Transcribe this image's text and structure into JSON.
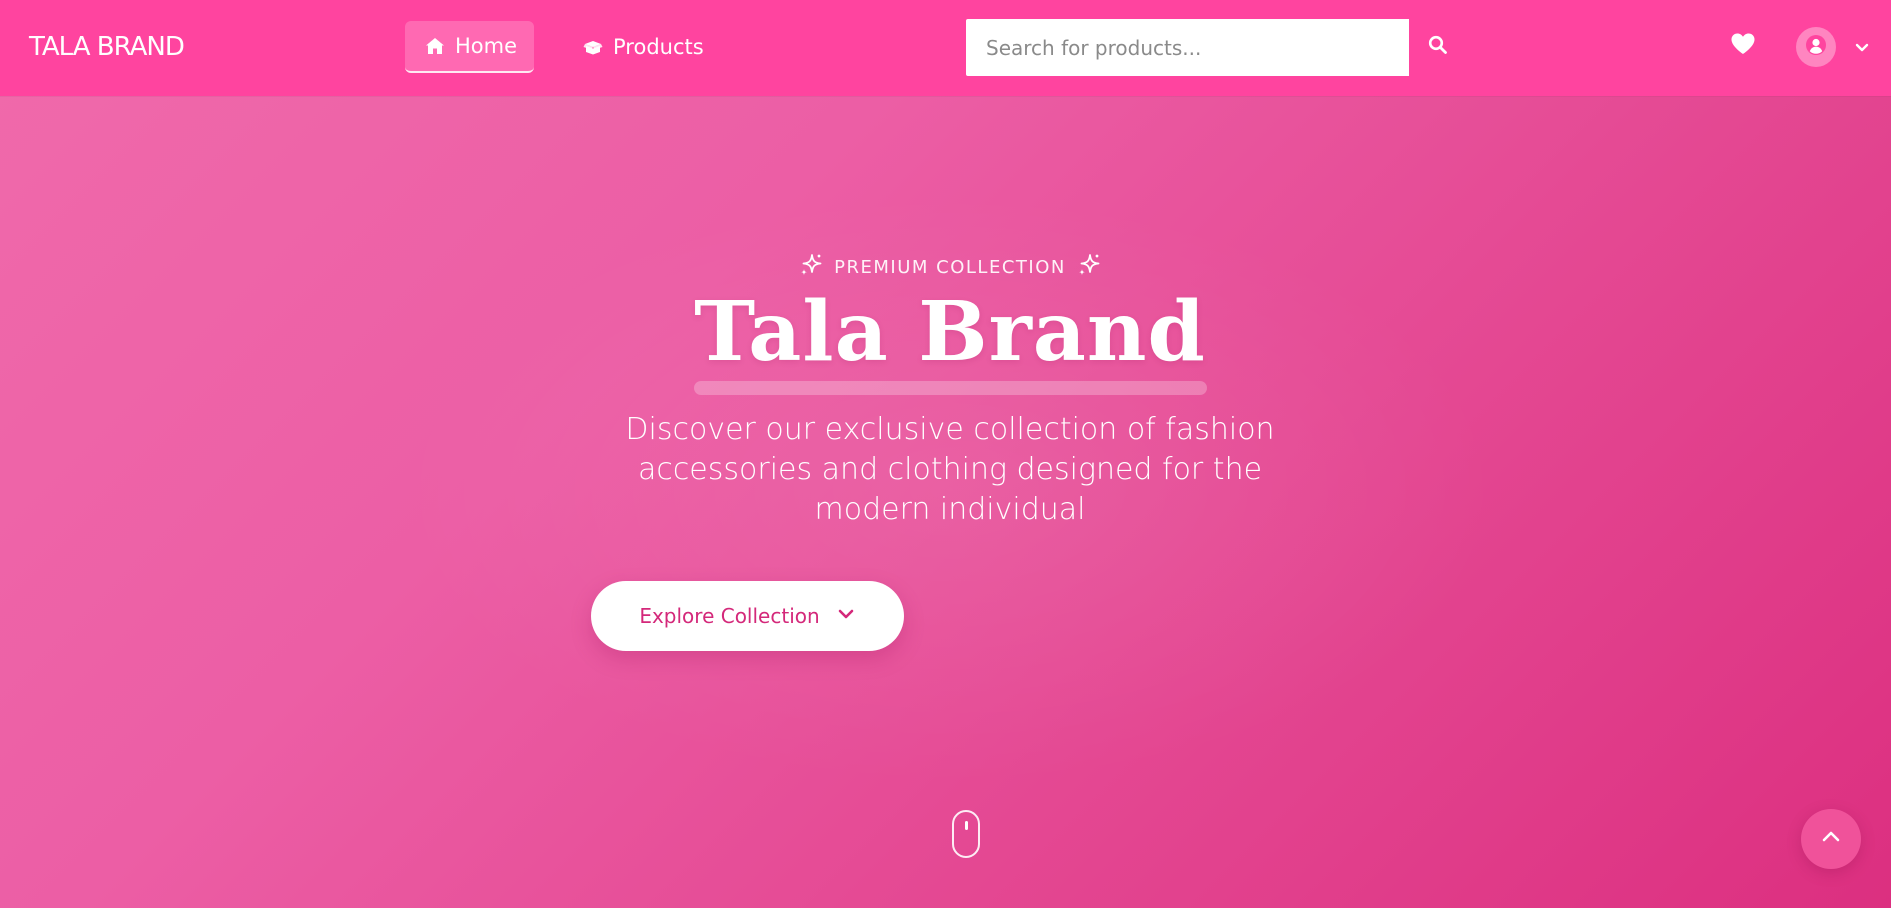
{
  "header": {
    "brand": "TALA BRAND",
    "nav": [
      {
        "label": "Home",
        "icon": "home-icon",
        "active": true
      },
      {
        "label": "Products",
        "icon": "box-open-icon",
        "active": false
      }
    ],
    "search": {
      "placeholder": "Search for products...",
      "value": ""
    },
    "icons": {
      "search": "search-icon",
      "wishlist": "heart-icon",
      "account": "user-circle-icon",
      "account_menu": "chevron-down-icon"
    }
  },
  "hero": {
    "eyebrow": "PREMIUM COLLECTION",
    "title": "Tala Brand",
    "subtitle": "Discover our exclusive collection of fashion accessories and clothing designed for the modern individual",
    "cta_label": "Explore Collection",
    "icons": {
      "sparkle": "sparkle-icon",
      "cta": "chevron-down-icon",
      "scroll": "mouse-scroll-icon"
    }
  },
  "back_to_top": {
    "icon": "chevron-up-icon"
  },
  "colors": {
    "nav_bg": "#ff449f",
    "hero_start": "#f06aab",
    "hero_end": "#dc2f80",
    "cta_text": "#d4287a",
    "white": "#ffffff"
  }
}
